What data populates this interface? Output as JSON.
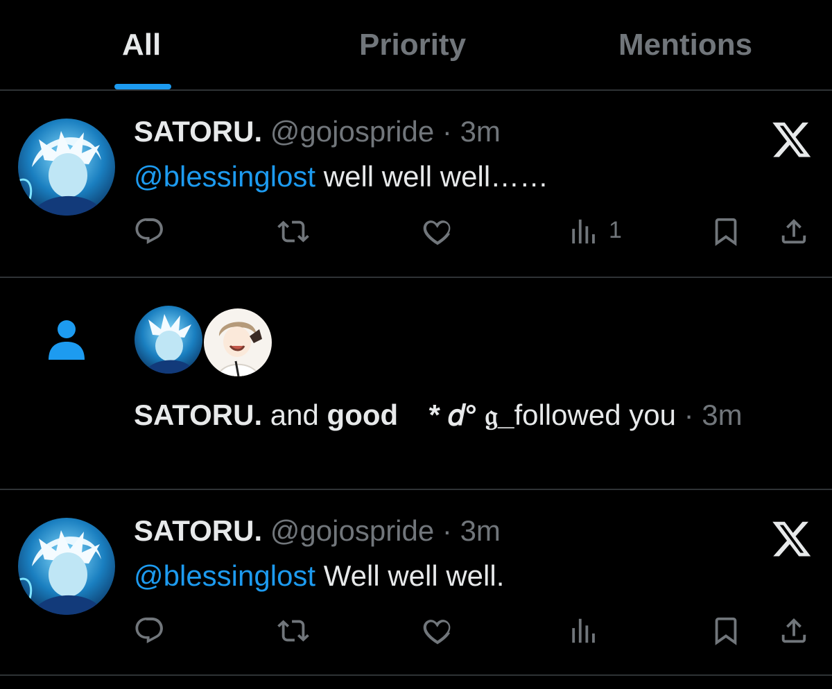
{
  "tabs": [
    {
      "label": "All",
      "active": true
    },
    {
      "label": "Priority",
      "active": false
    },
    {
      "label": "Mentions",
      "active": false
    }
  ],
  "colors": {
    "background": "#000000",
    "accent": "#1d9bf0",
    "text_primary": "#e7e9ea",
    "text_secondary": "#71767b",
    "divider": "#2f3336"
  },
  "notifications": [
    {
      "type": "mention",
      "author_name": "SATORU.",
      "author_handle": "@gojospride",
      "time": "3m",
      "mention": "@blessinglost",
      "text": " well well well……",
      "views": "1",
      "icon": "x-logo-icon"
    },
    {
      "type": "follow",
      "names": [
        "SATORU.",
        "good ⠀* 𝑑° 𝔤_"
      ],
      "joiner": " and ",
      "action": "followed you",
      "separator": " · ",
      "time": "3m",
      "icon": "person-icon"
    },
    {
      "type": "mention",
      "author_name": "SATORU.",
      "author_handle": "@gojospride",
      "time": "3m",
      "mention": "@blessinglost",
      "text": " Well well well.",
      "views": "",
      "icon": "x-logo-icon"
    }
  ],
  "separator": " · "
}
